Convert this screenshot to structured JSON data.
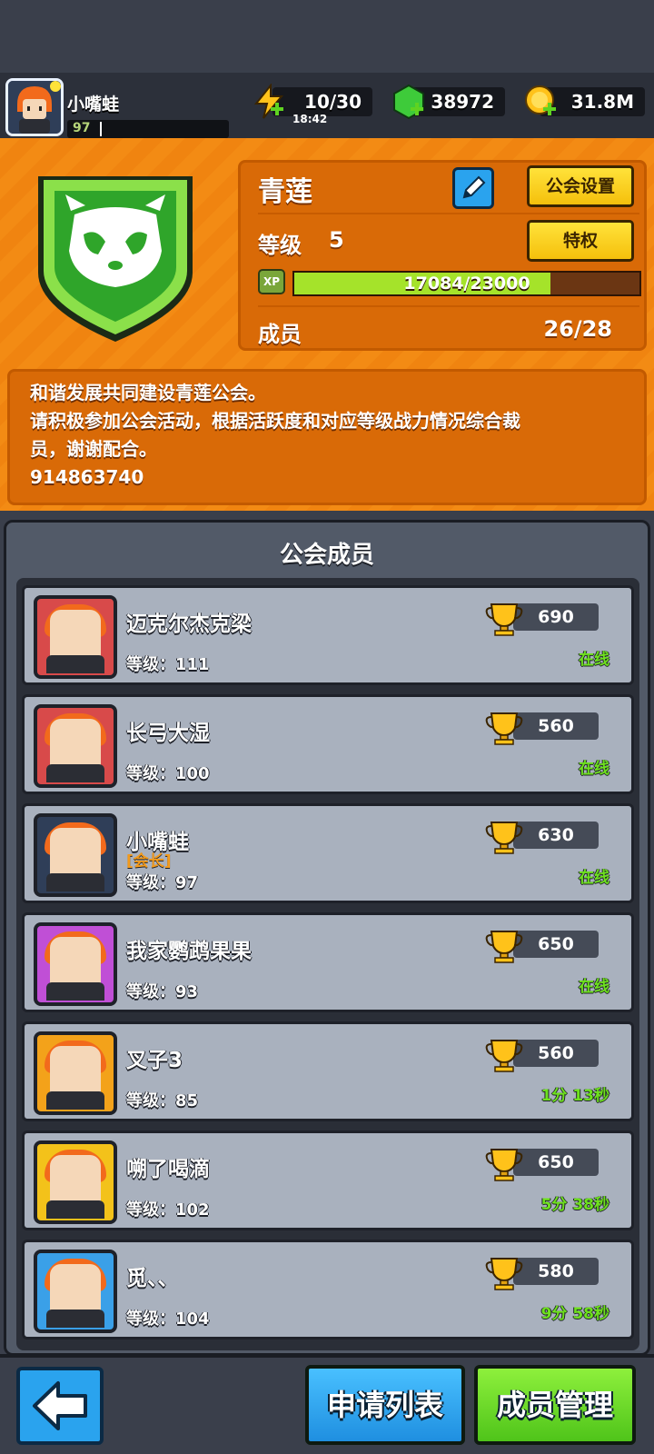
{
  "player": {
    "name": "小嘴蛙",
    "level": "97"
  },
  "resources": {
    "energy": "10/30",
    "energy_timer": "18:42",
    "gems": "38972",
    "coins": "31.8M"
  },
  "guild": {
    "name": "青莲",
    "settings_label": "公会设置",
    "privilege_label": "特权",
    "level_label": "等级",
    "level_value": "5",
    "xp_text": "17084/23000",
    "xp_current": 17084,
    "xp_max": 23000,
    "xp_badge": "XP",
    "members_label": "成员",
    "members_value": "26/28",
    "notice_lines": [
      "和谐发展共同建设青莲公会。",
      "请积极参加公会活动，根据活跃度和对应等级战力情况综合裁",
      "员，谢谢配合。",
      "914863740"
    ]
  },
  "members_section": {
    "title": "公会成员"
  },
  "members": [
    {
      "name": "迈克尔杰克梁",
      "role": "",
      "level": "等级：111",
      "score": "690",
      "status": "在线",
      "frame": "#d84a4a"
    },
    {
      "name": "长弓大湿",
      "role": "",
      "level": "等级：100",
      "score": "560",
      "status": "在线",
      "frame": "#d84a4a"
    },
    {
      "name": "小嘴蛙",
      "role": "[会长]",
      "level": "等级：97",
      "score": "630",
      "status": "在线",
      "frame": "#2f3e58"
    },
    {
      "name": "我家鹦鹉果果",
      "role": "",
      "level": "等级：93",
      "score": "650",
      "status": "在线",
      "frame": "#c04fd6"
    },
    {
      "name": "叉子3",
      "role": "",
      "level": "等级：85",
      "score": "560",
      "status": "1分 13秒",
      "frame": "#f3a21a"
    },
    {
      "name": "嗍了喝滴",
      "role": "",
      "level": "等级：102",
      "score": "650",
      "status": "5分 38秒",
      "frame": "#f3c21a"
    },
    {
      "name": "觅、、",
      "role": "",
      "level": "等级：104",
      "score": "580",
      "status": "9分 58秒",
      "frame": "#3aa0e8"
    }
  ],
  "buttons": {
    "apply_list": "申请列表",
    "member_manage": "成员管理"
  },
  "colors": {
    "orange_bg": "#f38b14",
    "online_green": "#6ee11e",
    "xp_green": "#a5e32a",
    "blue_btn": "#2aa3ee",
    "green_btn": "#5fd321"
  }
}
